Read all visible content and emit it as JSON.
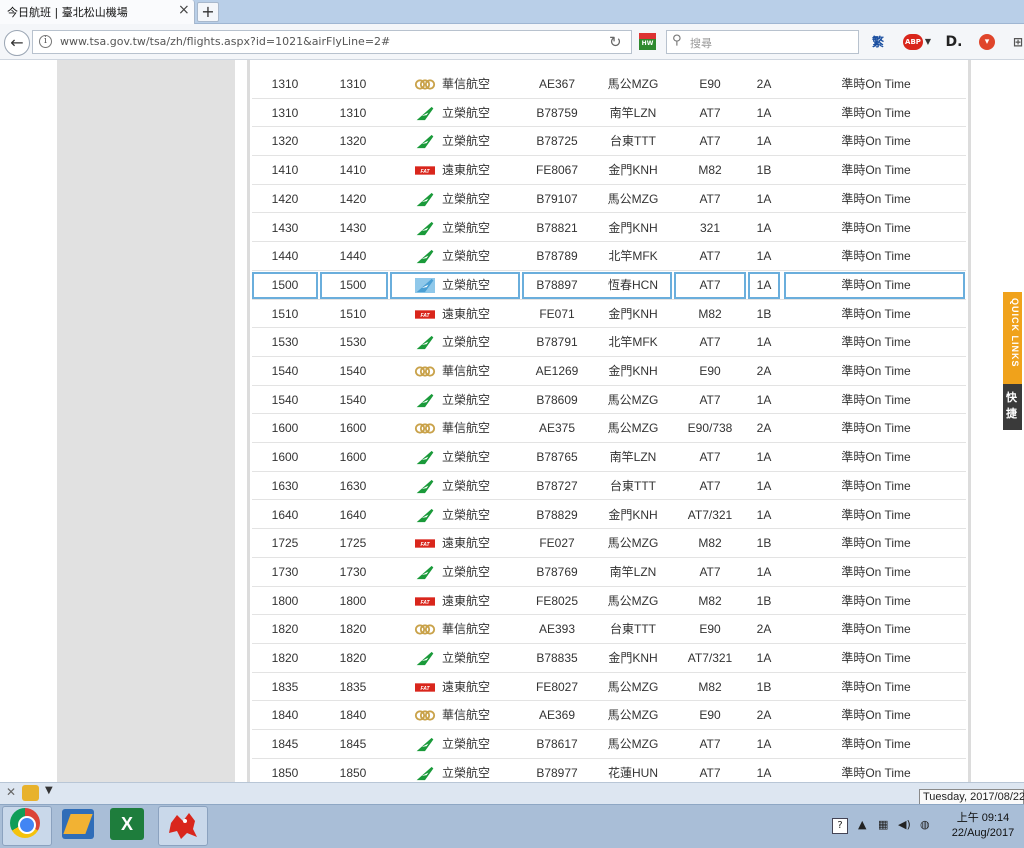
{
  "tab": {
    "title": "今日航班 | 臺北松山機場",
    "close": "×",
    "new_tab": "+"
  },
  "nav": {
    "url": "www.tsa.gov.tw/tsa/zh/flights.aspx?id=1021&airFlyLine=2#",
    "search_placeholder": "搜尋",
    "back": "←",
    "reload": "↻",
    "info": "i",
    "extensions": [
      "HW",
      "繁",
      "ABP",
      "D.",
      "●"
    ]
  },
  "flights": [
    {
      "sched": "1310",
      "actual": "1310",
      "airline": "華信航空",
      "logo": "mandarin",
      "flight": "AE367",
      "dest": "馬公MZG",
      "aircraft": "E90",
      "terminal": "2A",
      "status": "準時On Time"
    },
    {
      "sched": "1310",
      "actual": "1310",
      "airline": "立榮航空",
      "logo": "uni",
      "flight": "B78759",
      "dest": "南竿LZN",
      "aircraft": "AT7",
      "terminal": "1A",
      "status": "準時On Time"
    },
    {
      "sched": "1320",
      "actual": "1320",
      "airline": "立榮航空",
      "logo": "uni",
      "flight": "B78725",
      "dest": "台東TTT",
      "aircraft": "AT7",
      "terminal": "1A",
      "status": "準時On Time"
    },
    {
      "sched": "1410",
      "actual": "1410",
      "airline": "遠東航空",
      "logo": "fat",
      "flight": "FE8067",
      "dest": "金門KNH",
      "aircraft": "M82",
      "terminal": "1B",
      "status": "準時On Time"
    },
    {
      "sched": "1420",
      "actual": "1420",
      "airline": "立榮航空",
      "logo": "uni",
      "flight": "B79107",
      "dest": "馬公MZG",
      "aircraft": "AT7",
      "terminal": "1A",
      "status": "準時On Time"
    },
    {
      "sched": "1430",
      "actual": "1430",
      "airline": "立榮航空",
      "logo": "uni",
      "flight": "B78821",
      "dest": "金門KNH",
      "aircraft": "321",
      "terminal": "1A",
      "status": "準時On Time"
    },
    {
      "sched": "1440",
      "actual": "1440",
      "airline": "立榮航空",
      "logo": "uni",
      "flight": "B78789",
      "dest": "北竿MFK",
      "aircraft": "AT7",
      "terminal": "1A",
      "status": "準時On Time"
    },
    {
      "sched": "1500",
      "actual": "1500",
      "airline": "立榮航空",
      "logo": "uni-selected",
      "flight": "B78897",
      "dest": "恆春HCN",
      "aircraft": "AT7",
      "terminal": "1A",
      "status": "準時On Time"
    },
    {
      "sched": "1510",
      "actual": "1510",
      "airline": "遠東航空",
      "logo": "fat",
      "flight": "FE071",
      "dest": "金門KNH",
      "aircraft": "M82",
      "terminal": "1B",
      "status": "準時On Time"
    },
    {
      "sched": "1530",
      "actual": "1530",
      "airline": "立榮航空",
      "logo": "uni",
      "flight": "B78791",
      "dest": "北竿MFK",
      "aircraft": "AT7",
      "terminal": "1A",
      "status": "準時On Time"
    },
    {
      "sched": "1540",
      "actual": "1540",
      "airline": "華信航空",
      "logo": "mandarin",
      "flight": "AE1269",
      "dest": "金門KNH",
      "aircraft": "E90",
      "terminal": "2A",
      "status": "準時On Time"
    },
    {
      "sched": "1540",
      "actual": "1540",
      "airline": "立榮航空",
      "logo": "uni",
      "flight": "B78609",
      "dest": "馬公MZG",
      "aircraft": "AT7",
      "terminal": "1A",
      "status": "準時On Time"
    },
    {
      "sched": "1600",
      "actual": "1600",
      "airline": "華信航空",
      "logo": "mandarin",
      "flight": "AE375",
      "dest": "馬公MZG",
      "aircraft": "E90/738",
      "terminal": "2A",
      "status": "準時On Time"
    },
    {
      "sched": "1600",
      "actual": "1600",
      "airline": "立榮航空",
      "logo": "uni",
      "flight": "B78765",
      "dest": "南竿LZN",
      "aircraft": "AT7",
      "terminal": "1A",
      "status": "準時On Time"
    },
    {
      "sched": "1630",
      "actual": "1630",
      "airline": "立榮航空",
      "logo": "uni",
      "flight": "B78727",
      "dest": "台東TTT",
      "aircraft": "AT7",
      "terminal": "1A",
      "status": "準時On Time"
    },
    {
      "sched": "1640",
      "actual": "1640",
      "airline": "立榮航空",
      "logo": "uni",
      "flight": "B78829",
      "dest": "金門KNH",
      "aircraft": "AT7/321",
      "terminal": "1A",
      "status": "準時On Time"
    },
    {
      "sched": "1725",
      "actual": "1725",
      "airline": "遠東航空",
      "logo": "fat",
      "flight": "FE027",
      "dest": "馬公MZG",
      "aircraft": "M82",
      "terminal": "1B",
      "status": "準時On Time"
    },
    {
      "sched": "1730",
      "actual": "1730",
      "airline": "立榮航空",
      "logo": "uni",
      "flight": "B78769",
      "dest": "南竿LZN",
      "aircraft": "AT7",
      "terminal": "1A",
      "status": "準時On Time"
    },
    {
      "sched": "1800",
      "actual": "1800",
      "airline": "遠東航空",
      "logo": "fat",
      "flight": "FE8025",
      "dest": "馬公MZG",
      "aircraft": "M82",
      "terminal": "1B",
      "status": "準時On Time"
    },
    {
      "sched": "1820",
      "actual": "1820",
      "airline": "華信航空",
      "logo": "mandarin",
      "flight": "AE393",
      "dest": "台東TTT",
      "aircraft": "E90",
      "terminal": "2A",
      "status": "準時On Time"
    },
    {
      "sched": "1820",
      "actual": "1820",
      "airline": "立榮航空",
      "logo": "uni",
      "flight": "B78835",
      "dest": "金門KNH",
      "aircraft": "AT7/321",
      "terminal": "1A",
      "status": "準時On Time"
    },
    {
      "sched": "1835",
      "actual": "1835",
      "airline": "遠東航空",
      "logo": "fat",
      "flight": "FE8027",
      "dest": "馬公MZG",
      "aircraft": "M82",
      "terminal": "1B",
      "status": "準時On Time"
    },
    {
      "sched": "1840",
      "actual": "1840",
      "airline": "華信航空",
      "logo": "mandarin",
      "flight": "AE369",
      "dest": "馬公MZG",
      "aircraft": "E90",
      "terminal": "2A",
      "status": "準時On Time"
    },
    {
      "sched": "1845",
      "actual": "1845",
      "airline": "立榮航空",
      "logo": "uni",
      "flight": "B78617",
      "dest": "馬公MZG",
      "aircraft": "AT7",
      "terminal": "1A",
      "status": "準時On Time"
    },
    {
      "sched": "1850",
      "actual": "1850",
      "airline": "立榮航空",
      "logo": "uni",
      "flight": "B78977",
      "dest": "花蓮HUN",
      "aircraft": "AT7",
      "terminal": "1A",
      "status": "準時On Time"
    }
  ],
  "quick_links": {
    "label": "QUICK LINKS",
    "sub": "快捷"
  },
  "tooltip": "Tuesday, 2017/08/22",
  "clock": {
    "time": "上午 09:14",
    "date": "22/Aug/2017"
  },
  "colors": {
    "uni_green": "#1a9a3a",
    "fat_red": "#d9261c",
    "mandarin_gold": "#c9a24a",
    "selection_blue": "#6aaedc",
    "quicklinks_orange": "#f0a21b"
  }
}
